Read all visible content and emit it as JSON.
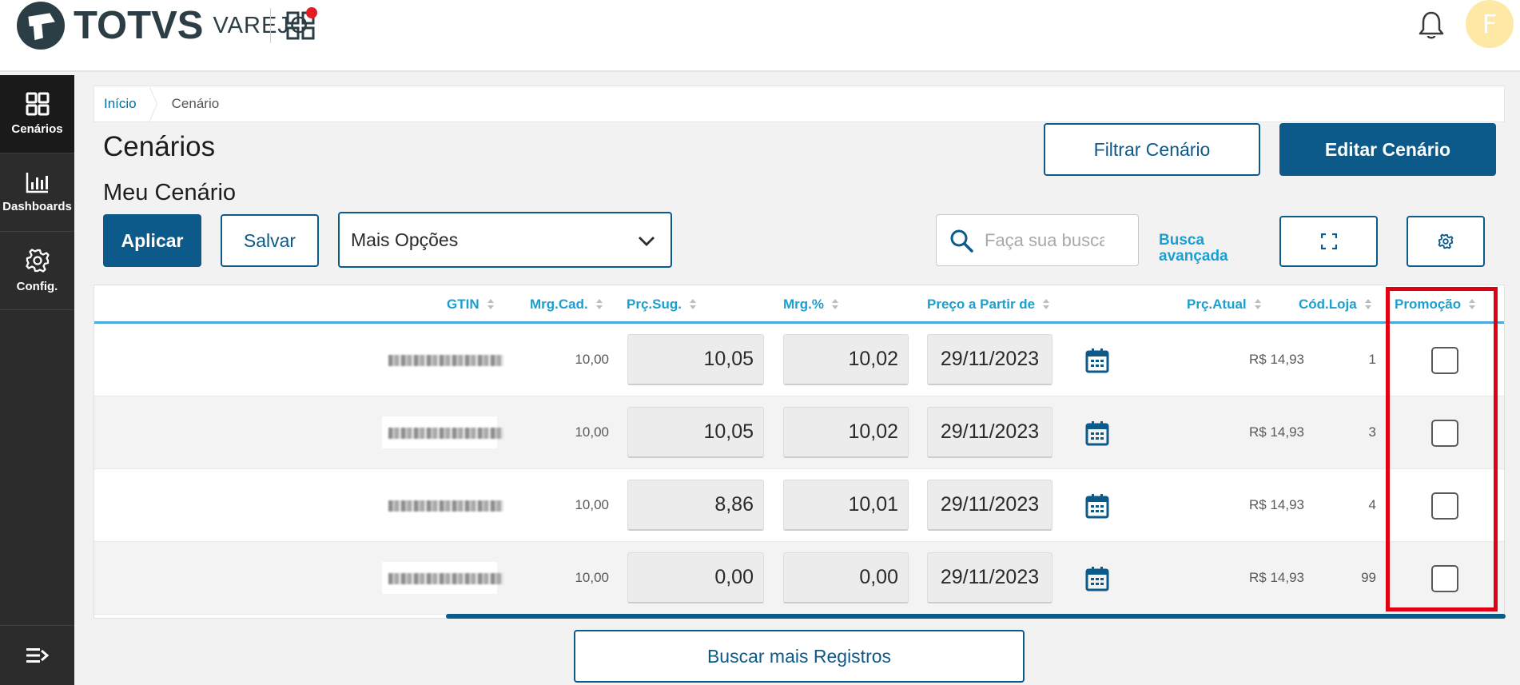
{
  "header": {
    "logo_text": "TOTVS",
    "logo_sub": "VAREJO",
    "avatar_initial": "F"
  },
  "sidebar": {
    "items": [
      {
        "label": "Cenários",
        "icon": "grid-icon",
        "active": true
      },
      {
        "label": "Dashboards",
        "icon": "bar-chart-icon",
        "active": false
      },
      {
        "label": "Config.",
        "icon": "gear-icon",
        "active": false
      }
    ],
    "bottom_icon": "menu-collapse-icon"
  },
  "breadcrumb": {
    "home": "Início",
    "current": "Cenário"
  },
  "page": {
    "title": "Cenários",
    "section_title": "Meu Cenário"
  },
  "toolbar": {
    "filter_label": "Filtrar Cenário",
    "edit_label": "Editar Cenário",
    "apply_label": "Aplicar",
    "save_label": "Salvar",
    "options_selected": "Mais Opções",
    "search_placeholder": "Faça sua busca",
    "advanced_search_line1": "Busca",
    "advanced_search_line2": "avançada"
  },
  "table": {
    "columns": {
      "gtin": "GTIN",
      "mrg_cad": "Mrg.Cad.",
      "prc_sug": "Prç.Sug.",
      "mrg_pct": "Mrg.%",
      "preco_partir": "Preço a Partir de",
      "prc_atual": "Prç.Atual",
      "cod_loja": "Cód.Loja",
      "promocao": "Promoção"
    },
    "rows": [
      {
        "mrg_cad": "10,00",
        "prc_sug": "10,05",
        "mrg_pct": "10,02",
        "date": "29/11/2023",
        "prc_atual": "R$ 14,93",
        "cod_loja": "1",
        "promocao": false
      },
      {
        "mrg_cad": "10,00",
        "prc_sug": "10,05",
        "mrg_pct": "10,02",
        "date": "29/11/2023",
        "prc_atual": "R$ 14,93",
        "cod_loja": "3",
        "promocao": false
      },
      {
        "mrg_cad": "10,00",
        "prc_sug": "8,86",
        "mrg_pct": "10,01",
        "date": "29/11/2023",
        "prc_atual": "R$ 14,93",
        "cod_loja": "4",
        "promocao": false
      },
      {
        "mrg_cad": "10,00",
        "prc_sug": "0,00",
        "mrg_pct": "0,00",
        "date": "29/11/2023",
        "prc_atual": "R$ 14,93",
        "cod_loja": "99",
        "promocao": false
      }
    ]
  },
  "footer": {
    "more_label": "Buscar mais Registros"
  },
  "colors": {
    "primary": "#0c5a8a",
    "link": "#1a9fd1",
    "sidebar": "#2c2c2c",
    "highlight": "#e10012",
    "avatar": "#fde8a6"
  }
}
